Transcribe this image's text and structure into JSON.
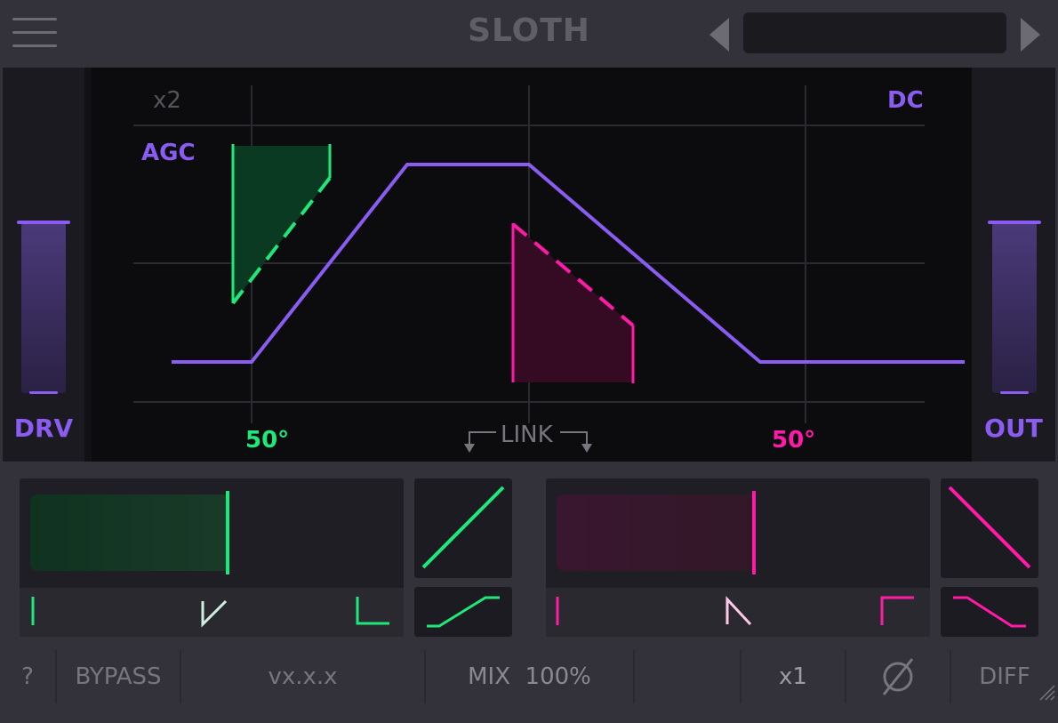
{
  "header": {
    "title": "SLOTH",
    "preset_name": ""
  },
  "graph": {
    "top_left_label": "x2",
    "top_right_label": "DC",
    "agc_label": "AGC",
    "left_angle": "50°",
    "right_angle": "50°",
    "link_label": "LINK"
  },
  "sliders": {
    "drive_label": "DRV",
    "output_label": "OUT"
  },
  "footer": {
    "help": "?",
    "bypass": "BYPASS",
    "version": "vx.x.x",
    "mix_label": "MIX",
    "mix_value": "100%",
    "oversample": "x1",
    "diff": "DIFF"
  },
  "colors": {
    "accent_purple": "#8a5cf2",
    "green": "#1fe87a",
    "pink": "#ff1aa8",
    "background": "#0c0c0f"
  },
  "icons": {
    "menu": "hamburger-icon",
    "prev": "triangle-left-icon",
    "next": "triangle-right-icon",
    "phase": "phase-invert-icon",
    "resize": "resize-grip-icon"
  }
}
